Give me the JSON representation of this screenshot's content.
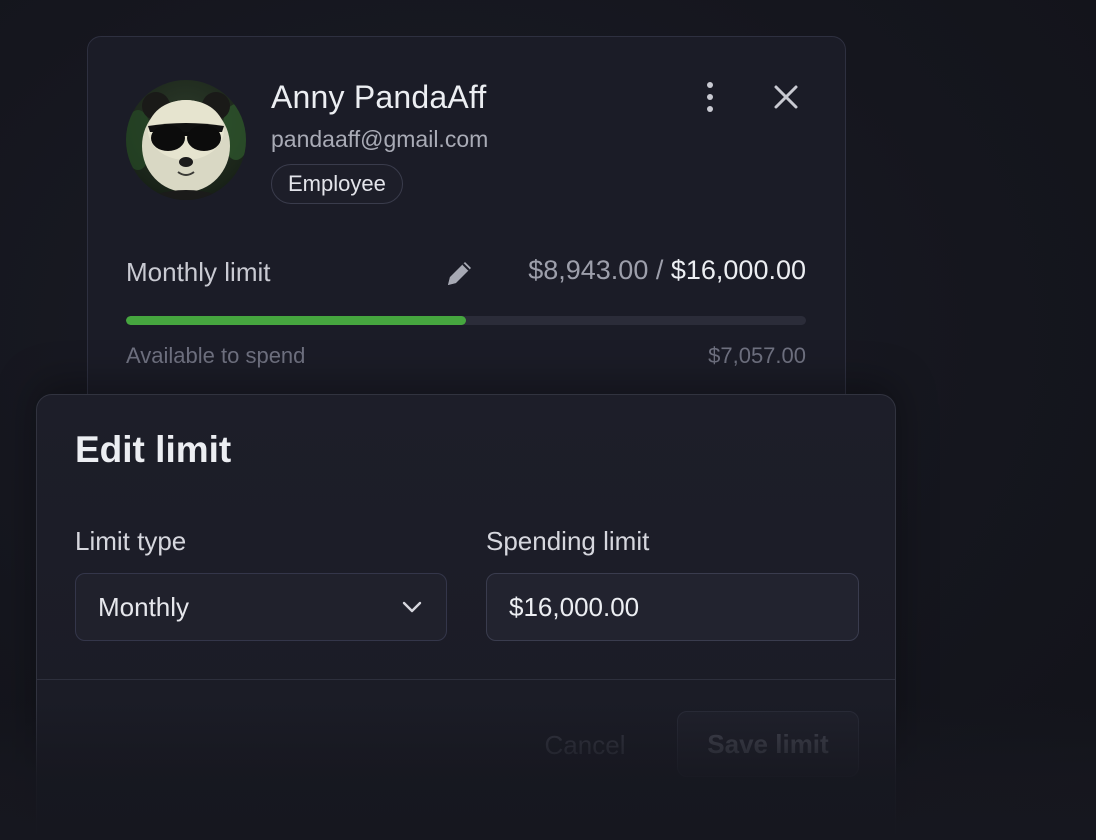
{
  "user": {
    "name": "Anny PandaAff",
    "email": "pandaaff@gmail.com",
    "role": "Employee",
    "avatar_icon": "panda-avatar"
  },
  "limit": {
    "label": "Monthly limit",
    "spent": "$8,943.00",
    "separator": " / ",
    "total": "$16,000.00",
    "progress_fraction": 0.5,
    "available_label": "Available to spend",
    "available_value": "$7,057.00",
    "progress_color": "#46a63f"
  },
  "icons": {
    "more": "more-vertical-icon",
    "close": "close-icon",
    "edit": "pencil-icon",
    "chevron": "chevron-down-icon"
  },
  "modal": {
    "title": "Edit limit",
    "limit_type_label": "Limit type",
    "limit_type_value": "Monthly",
    "spending_limit_label": "Spending limit",
    "spending_limit_value": "$16,000.00",
    "cancel_label": "Cancel",
    "save_label": "Save limit"
  }
}
